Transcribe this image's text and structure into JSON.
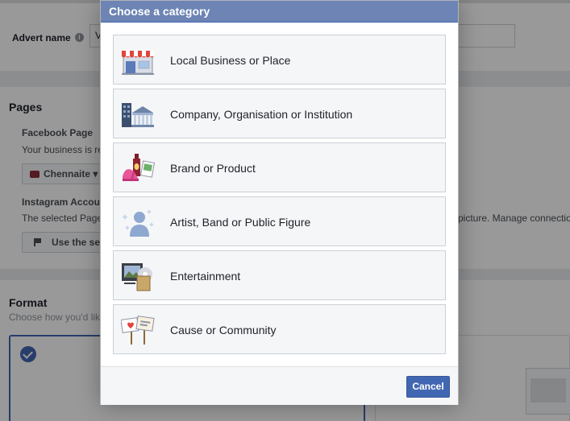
{
  "background": {
    "advert_name_label": "Advert name",
    "advert_name_value": "V",
    "pages_title": "Pages",
    "facebook_page_label": "Facebook Page",
    "facebook_page_desc": "Your business is re",
    "selected_page": "Chennaite",
    "instagram_label": "Instagram Accou",
    "instagram_desc": "The selected Page",
    "instagram_desc_right": "picture. Manage connection",
    "use_button_label": "Use the se",
    "format_title": "Format",
    "format_desc": "Choose how you'd lik"
  },
  "modal": {
    "title": "Choose a category",
    "categories": [
      {
        "label": "Local Business or Place",
        "icon": "storefront-icon"
      },
      {
        "label": "Company, Organisation or Institution",
        "icon": "institution-building-icon"
      },
      {
        "label": "Brand or Product",
        "icon": "brand-product-icon"
      },
      {
        "label": "Artist, Band or Public Figure",
        "icon": "public-figure-icon"
      },
      {
        "label": "Entertainment",
        "icon": "entertainment-icon"
      },
      {
        "label": "Cause or Community",
        "icon": "cause-signs-icon"
      }
    ],
    "cancel_label": "Cancel"
  },
  "colors": {
    "header": "#6d84b4",
    "primary_button": "#4267b2",
    "item_background": "#f5f6f7",
    "overlay": "rgba(0,0,0,0.4)"
  }
}
